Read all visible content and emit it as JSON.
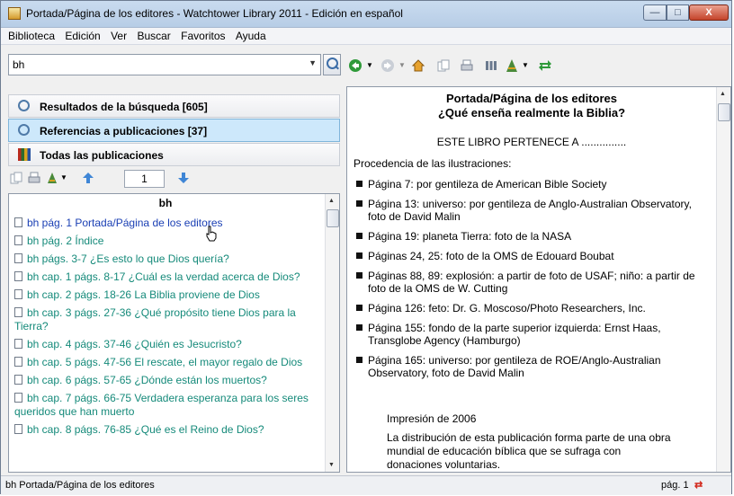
{
  "window": {
    "title": "Portada/Página de los editores - Watchtower Library 2011 - Edición en español",
    "min_glyph": "—",
    "max_glyph": "□",
    "close_glyph": "X"
  },
  "menu": [
    "Biblioteca",
    "Edición",
    "Ver",
    "Buscar",
    "Favoritos",
    "Ayuda"
  ],
  "search": {
    "value": "bh"
  },
  "nav": {
    "search_results": "Resultados de la búsqueda [605]",
    "publication_refs": "Referencias a publicaciones [37]",
    "all_publications": "Todas las publicaciones"
  },
  "left_toolbar": {
    "page": "1"
  },
  "pub_list": {
    "heading": "bh",
    "items": [
      "bh pág. 1 Portada/Página de los editores",
      "bh pág. 2 Índice",
      "bh págs. 3-7 ¿Es esto lo que Dios quería?",
      "bh cap. 1 págs. 8-17 ¿Cuál es la verdad acerca de Dios?",
      "bh cap. 2 págs. 18-26 La Biblia proviene de Dios",
      "bh cap. 3 págs. 27-36 ¿Qué propósito tiene Dios para la Tierra?",
      "bh cap. 4 págs. 37-46 ¿Quién es Jesucristo?",
      "bh cap. 5 págs. 47-56 El rescate, el mayor regalo de Dios",
      "bh cap. 6 págs. 57-65 ¿Dónde están los muertos?",
      "bh cap. 7 págs. 66-75 Verdadera esperanza para los seres queridos que han muerto",
      "bh cap. 8 págs. 76-85 ¿Qué es el Reino de Dios?"
    ]
  },
  "document": {
    "title": "Portada/Página de los editores",
    "subtitle": "¿Qué enseña realmente la Biblia?",
    "owner": "ESTE LIBRO PERTENECE A ...............",
    "procedencia": "Procedencia de las ilustraciones:",
    "items": [
      "Página 7: por gentileza de American Bible Society",
      "Página 13: universo: por gentileza de Anglo-Australian Observatory, foto de David Malin",
      "Página 19: planeta Tierra: foto de la NASA",
      "Páginas 24, 25: foto de la OMS de Edouard Boubat",
      "Páginas 88, 89: explosión: a partir de foto de USAF; niño: a partir de foto de la OMS de W. Cutting",
      "Página 126: feto: Dr. G. Moscoso/Photo Researchers, Inc.",
      "Página 155: fondo de la parte superior izquierda: Ernst Haas, Transglobe Agency (Hamburgo)",
      "Página 165: universo: por gentileza de ROE/Anglo-Australian Observatory, foto de David Malin"
    ],
    "impresion": "Impresión de 2006",
    "distribution": "La distribución de esta publicación forma parte de una obra mundial de educación bíblica que se sufraga con donaciones voluntarias."
  },
  "status": {
    "text": "bh Portada/Página de los editores",
    "page": "pág. 1"
  },
  "colors": {
    "link": "#1a3fb4",
    "visited": "#158a7a",
    "selection": "#cde8fb",
    "sync": "#d2281c"
  }
}
